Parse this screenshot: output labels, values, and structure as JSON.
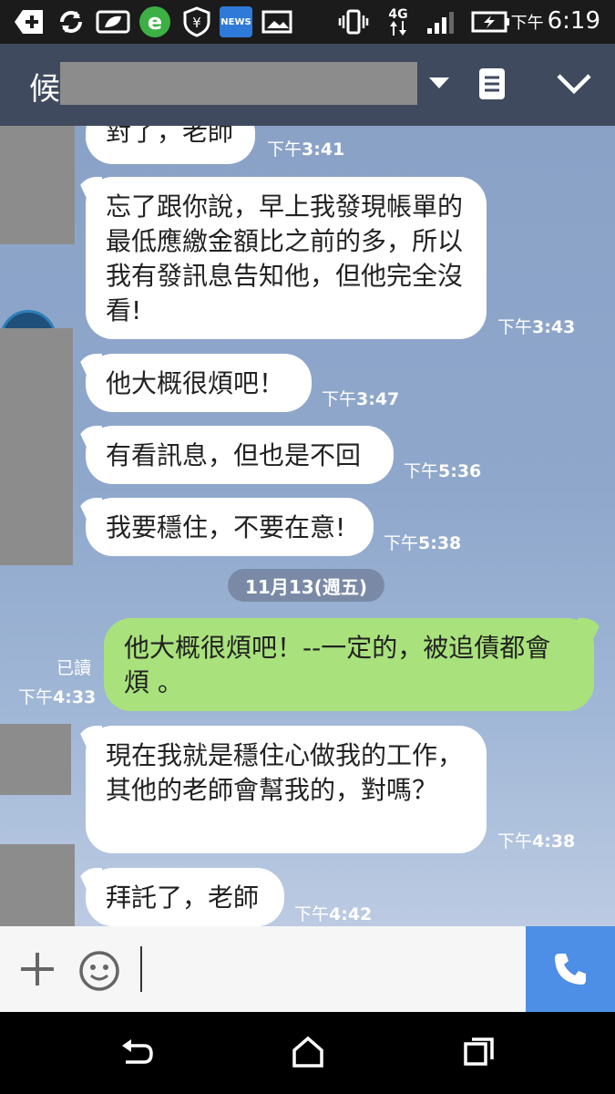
{
  "status_bar": {
    "time_prefix": "下午",
    "time": "6:19",
    "network": "4G",
    "icons": [
      "add-icon",
      "sync-icon",
      "leaf-icon",
      "browser-e-icon",
      "shield-yen-icon",
      "news-icon",
      "image-icon",
      "vibrate-icon",
      "network-4g-icon",
      "signal-icon",
      "battery-charging-icon"
    ],
    "news_label": "NEWS"
  },
  "header": {
    "title_visible": "候",
    "icons": [
      "dropdown-arrow-icon",
      "notes-icon",
      "chevron-down-icon"
    ]
  },
  "messages": [
    {
      "dir": "in",
      "text": "對了，老師",
      "time_prefix": "下午",
      "time": "3:41"
    },
    {
      "dir": "in",
      "text": "忘了跟你說，早上我發現帳單的最低應繳金額比之前的多，所以我有發訊息告知他，但他完全沒看!",
      "time_prefix": "下午",
      "time": "3:43"
    },
    {
      "dir": "in",
      "text": "他大概很煩吧！",
      "time_prefix": "下午",
      "time": "3:47"
    },
    {
      "dir": "in",
      "text": "有看訊息，但也是不回",
      "time_prefix": "下午",
      "time": "5:36"
    },
    {
      "dir": "in",
      "text": "我要穩住，不要在意!",
      "time_prefix": "下午",
      "time": "5:38"
    },
    {
      "dir": "out",
      "text": "他大概很煩吧！--一定的，被追債都會煩 。",
      "read": "已讀",
      "time_prefix": "下午",
      "time": "4:33"
    },
    {
      "dir": "in",
      "text": "現在我就是穩住心做我的工作，其他的老師會幫我的，對嗎？",
      "time_prefix": "下午",
      "time": "4:38"
    },
    {
      "dir": "in",
      "text": "拜託了，老師",
      "time_prefix": "下午",
      "time": "4:42"
    }
  ],
  "date_divider": "11月13(週五)",
  "input_bar": {
    "icons": [
      "plus-icon",
      "emoji-icon",
      "phone-call-icon"
    ],
    "placeholder": ""
  },
  "nav_bar": {
    "icons": [
      "back-icon",
      "home-icon",
      "recents-icon"
    ]
  },
  "colors": {
    "header": "#3f4a5e",
    "outgoing_bubble": "#a9e27c",
    "call_button": "#4d8ee6"
  }
}
